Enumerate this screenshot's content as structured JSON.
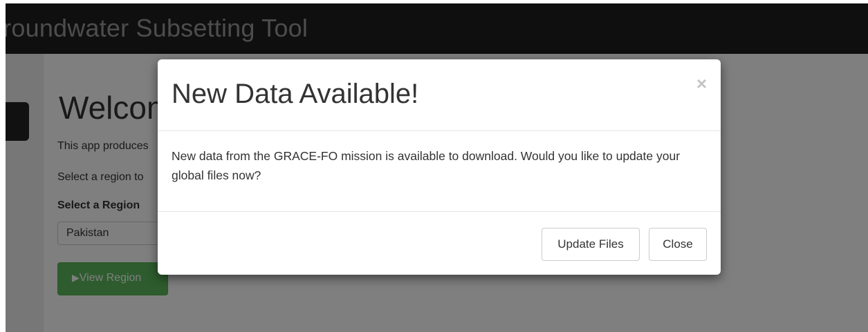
{
  "navbar": {
    "title": "Groundwater Subsetting Tool"
  },
  "page": {
    "welcome_title": "Welcome",
    "intro_text": "This app produces",
    "select_instruction": "Select a region to",
    "region_label": "Select a Region",
    "region_value": "Pakistan",
    "view_button_icon": "▶",
    "view_button_label": "View Region"
  },
  "modal": {
    "title": "New Data Available!",
    "close_symbol": "×",
    "body": "New data from the GRACE-FO mission is available to download. Would you like to update your global files now?",
    "update_button": "Update Files",
    "close_button": "Close"
  },
  "colors": {
    "navbar_bg": "#1f1f1f",
    "success_button": "#5cb85c",
    "backdrop": "rgba(0,0,0,0.5)"
  }
}
